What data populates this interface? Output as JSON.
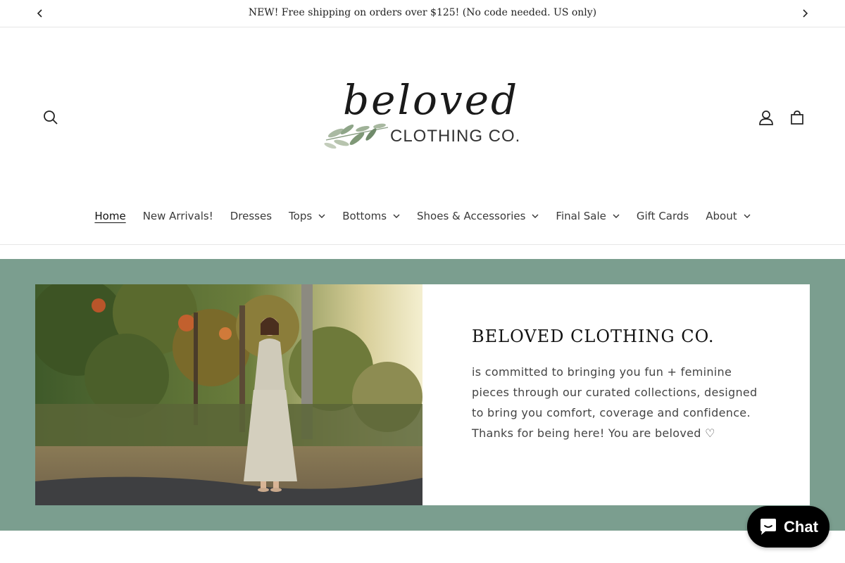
{
  "announcement": {
    "text": "NEW! Free shipping on orders over $125! (No code needed. US only)",
    "prev_icon": "chevron-left-icon",
    "next_icon": "chevron-right-icon"
  },
  "header": {
    "logo": {
      "script": "beloved",
      "subtitle": "CLOTHING CO."
    },
    "icons": {
      "search": "search-icon",
      "account": "account-icon",
      "cart": "cart-icon"
    }
  },
  "nav": {
    "items": [
      {
        "label": "Home",
        "active": true,
        "dropdown": false
      },
      {
        "label": "New Arrivals!",
        "dropdown": false
      },
      {
        "label": "Dresses",
        "dropdown": false
      },
      {
        "label": "Tops",
        "dropdown": true
      },
      {
        "label": "Bottoms",
        "dropdown": true
      },
      {
        "label": "Shoes & Accessories",
        "dropdown": true
      },
      {
        "label": "Final Sale",
        "dropdown": true
      },
      {
        "label": "Gift Cards",
        "dropdown": false
      },
      {
        "label": "About",
        "dropdown": true
      }
    ]
  },
  "hero": {
    "title": "BELOVED CLOTHING CO.",
    "body": "is committed to bringing you fun + feminine pieces through our curated collections, designed to bring you comfort, coverage and confidence. Thanks for being here! You are beloved ♡",
    "background_color": "#7b9e8f"
  },
  "chat": {
    "label": "Chat",
    "icon": "chat-bubble-icon"
  }
}
